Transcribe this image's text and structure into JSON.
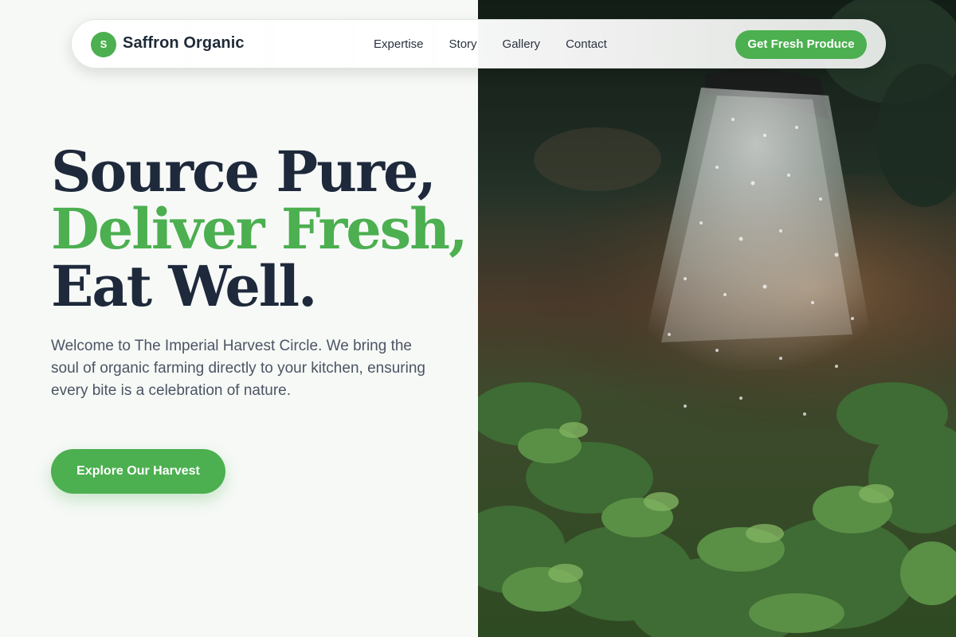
{
  "brand": {
    "badge": "S",
    "name": "Saffron Organic"
  },
  "nav": {
    "links": [
      "Expertise",
      "Story",
      "Gallery",
      "Contact"
    ],
    "cta": "Get Fresh Produce"
  },
  "hero": {
    "title_line1": "Source Pure,",
    "title_line2": "Deliver Fresh,",
    "title_line3": "Eat Well.",
    "description": "Welcome to The Imperial Harvest Circle. We bring the soul of organic farming directly to your kitchen, ensuring every bite is a celebration of nature.",
    "cta": "Explore Our Harvest"
  },
  "colors": {
    "accent": "#4caf50",
    "heading": "#1e293b",
    "body_text": "#4b5563",
    "background": "#f7f9f7"
  },
  "icons": {
    "hero_image": "watering-can-over-garden-photo"
  }
}
